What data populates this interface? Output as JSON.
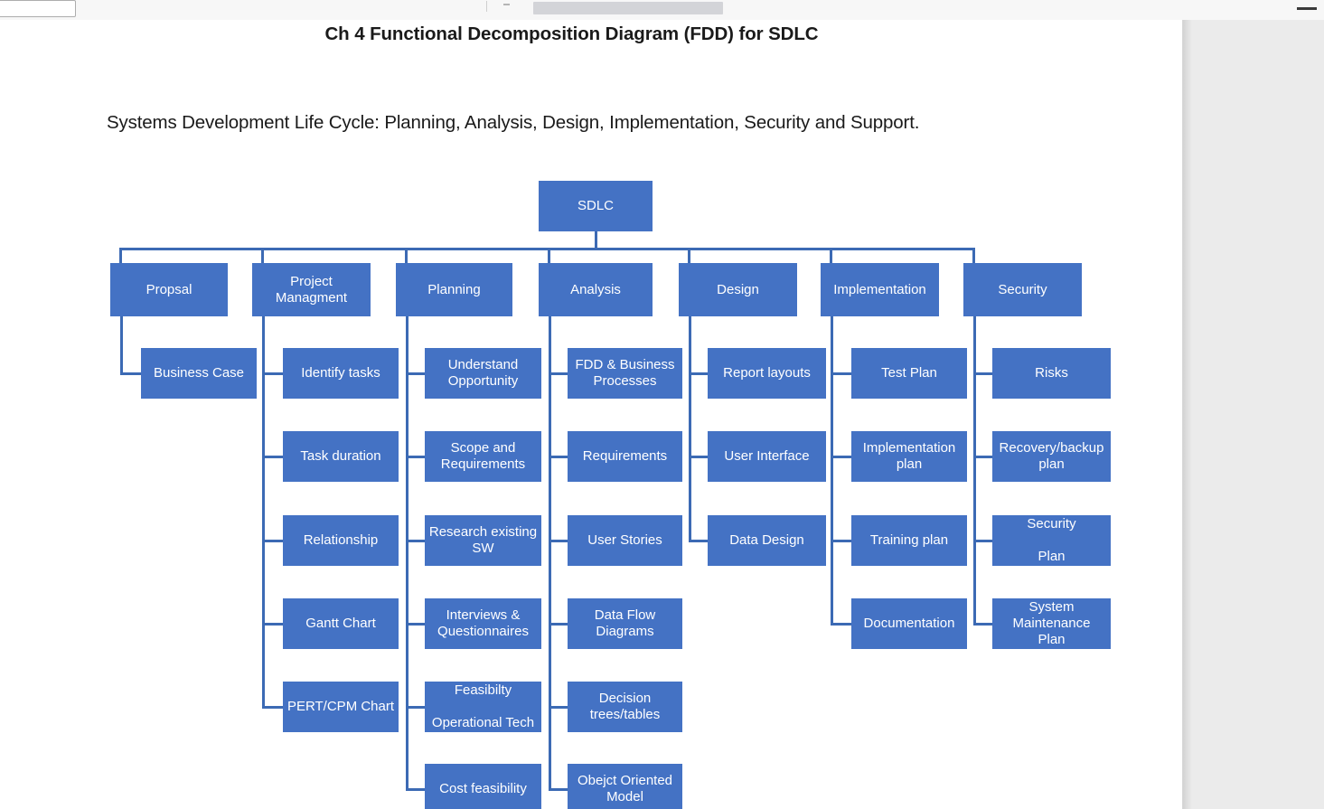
{
  "chrome": {
    "field_value": "",
    "progress_label": ""
  },
  "document": {
    "title": "Ch 4 Functional Decomposition Diagram (FDD) for SDLC",
    "subtitle": "Systems Development Life Cycle:  Planning, Analysis, Design, Implementation, Security and Support."
  },
  "colors": {
    "node_fill": "#4472c4",
    "node_text": "#ffffff",
    "connector": "#3c6ab4",
    "page_background": "#ffffff",
    "workspace_background": "#ebebeb"
  },
  "diagram": {
    "type": "functional-decomposition-tree",
    "root": {
      "label": "SDLC"
    },
    "branches": [
      {
        "label": "Propsal",
        "children": [
          {
            "label": "Business Case"
          }
        ]
      },
      {
        "label": "Project\nManagment",
        "children": [
          {
            "label": "Identify tasks"
          },
          {
            "label": "Task duration"
          },
          {
            "label": "Relationship"
          },
          {
            "label": "Gantt Chart"
          },
          {
            "label": "PERT/CPM Chart"
          }
        ]
      },
      {
        "label": "Planning",
        "children": [
          {
            "label": "Understand\nOpportunity"
          },
          {
            "label": "Scope and\nRequirements"
          },
          {
            "label": "Research existing\nSW"
          },
          {
            "label": "Interviews &\nQuestionnaires"
          },
          {
            "label": "Feasibilty\n\nOperational Tech"
          },
          {
            "label": "Cost feasibility"
          }
        ]
      },
      {
        "label": "Analysis",
        "children": [
          {
            "label": "FDD & Business\nProcesses"
          },
          {
            "label": "Requirements"
          },
          {
            "label": "User Stories"
          },
          {
            "label": "Data Flow\nDiagrams"
          },
          {
            "label": "Decision\ntrees/tables"
          },
          {
            "label": "Obejct Oriented\nModel"
          }
        ]
      },
      {
        "label": "Design",
        "children": [
          {
            "label": "Report layouts"
          },
          {
            "label": "User Interface"
          },
          {
            "label": "Data Design"
          }
        ]
      },
      {
        "label": "Implementation",
        "children": [
          {
            "label": "Test Plan"
          },
          {
            "label": "Implementation\nplan"
          },
          {
            "label": "Training plan"
          },
          {
            "label": "Documentation"
          }
        ]
      },
      {
        "label": "Security",
        "children": [
          {
            "label": "Risks"
          },
          {
            "label": "Recovery/backup\nplan"
          },
          {
            "label": "Security\n\nPlan"
          },
          {
            "label": "System\nMaintenance\nPlan"
          }
        ]
      }
    ]
  }
}
